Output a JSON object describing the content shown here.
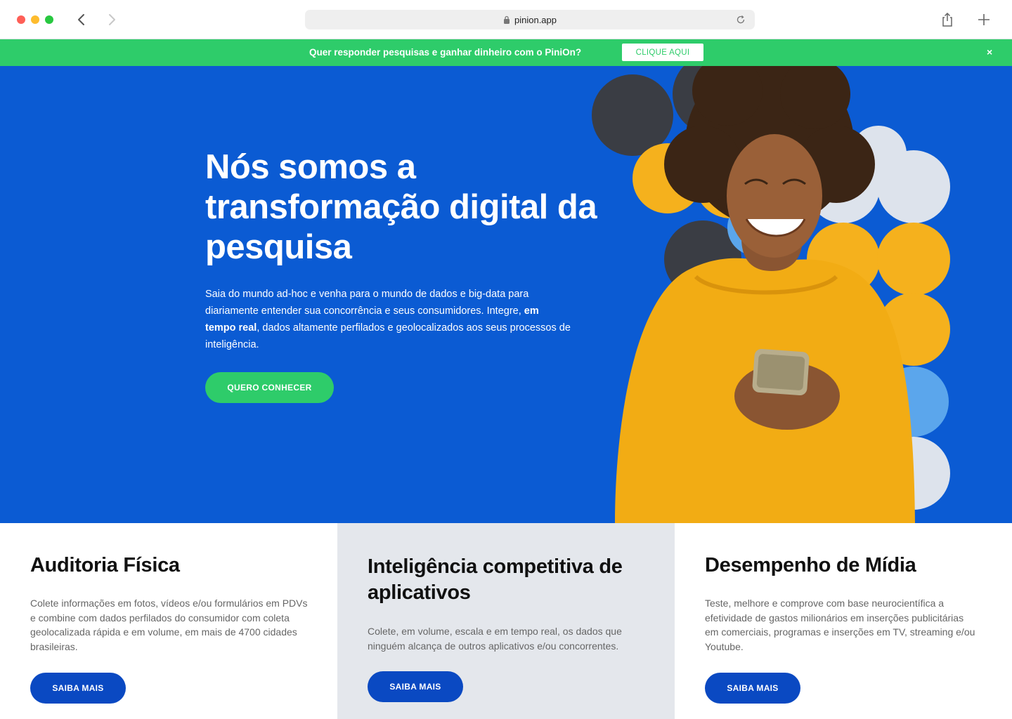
{
  "browser": {
    "url": "pinion.app"
  },
  "promo": {
    "text": "Quer responder pesquisas e ganhar dinheiro com o PiniOn?",
    "button": "CLIQUE AQUI",
    "close": "×"
  },
  "hero": {
    "title": "Nós somos a transformação digital da pesquisa",
    "desc_part1": "Saia do mundo ad-hoc e venha para o mundo de dados e big-data para diariamente entender sua concorrência e seus consumidores. Integre, ",
    "desc_bold": "em tempo real",
    "desc_part2": ", dados altamente perfilados e geolocalizados aos seus processos de inteligência.",
    "cta": "QUERO CONHECER"
  },
  "cards": [
    {
      "title": "Auditoria Física",
      "text": "Colete informações em fotos, vídeos e/ou formulários em PDVs e combine com dados perfilados do consumidor com coleta geolocalizada rápida e em volume, em mais de 4700 cidades brasileiras.",
      "button": "SAIBA MAIS"
    },
    {
      "title": "Inteligência competitiva de aplicativos",
      "text": "Colete, em volume, escala e em tempo real, os dados que ninguém alcança de outros aplicativos e/ou concorrentes.",
      "button": "SAIBA MAIS"
    },
    {
      "title": "Desempenho de Mídia",
      "text": "Teste, melhore e comprove com base neurocientífica a efetividade de gastos milionários em inserções publicitárias em comerciais, programas e inserções em TV, streaming e/ou Youtube.",
      "button": "SAIBA MAIS"
    }
  ],
  "colors": {
    "hero_bg": "#0b5bd3",
    "accent_green": "#2ecc6a",
    "button_blue": "#0a49c2",
    "sweater_yellow": "#f5b11d"
  }
}
